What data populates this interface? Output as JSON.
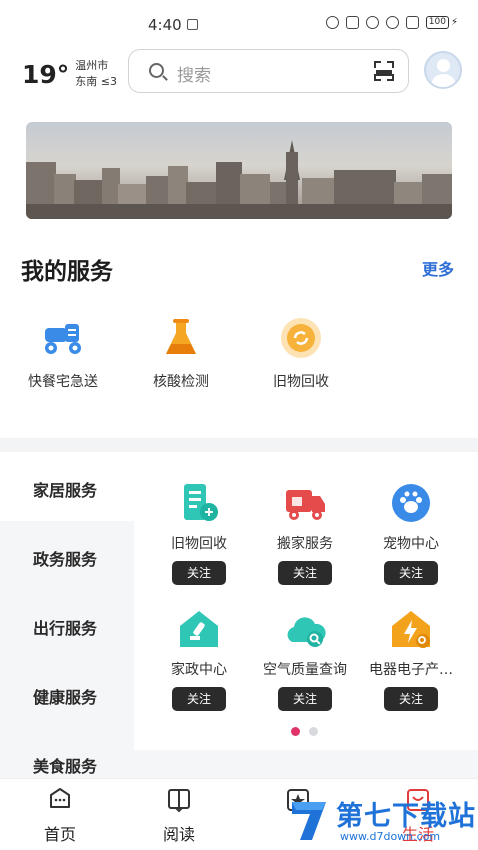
{
  "status_bar": {
    "time": "4:40",
    "battery": "100"
  },
  "header": {
    "temperature": "19°",
    "city": "温州市",
    "weather_sub": "东南 ≤3",
    "search_placeholder": "搜索"
  },
  "my_services": {
    "title": "我的服务",
    "more": "更多",
    "items": [
      {
        "label": "快餐宅急送",
        "icon": "delivery-scooter-icon"
      },
      {
        "label": "核酸检测",
        "icon": "test-tube-icon"
      },
      {
        "label": "旧物回收",
        "icon": "recycle-icon"
      }
    ]
  },
  "categories": [
    {
      "label": "家居服务",
      "active": true
    },
    {
      "label": "政务服务",
      "active": false
    },
    {
      "label": "出行服务",
      "active": false
    },
    {
      "label": "健康服务",
      "active": false
    },
    {
      "label": "美食服务",
      "active": false
    }
  ],
  "category_items": [
    {
      "label": "旧物回收",
      "button": "关注",
      "icon": "document-recycle-icon"
    },
    {
      "label": "搬家服务",
      "button": "关注",
      "icon": "moving-truck-icon"
    },
    {
      "label": "宠物中心",
      "button": "关注",
      "icon": "paw-icon"
    },
    {
      "label": "家政中心",
      "button": "关注",
      "icon": "house-cleaning-icon"
    },
    {
      "label": "空气质量查询",
      "button": "关注",
      "icon": "cloud-air-icon"
    },
    {
      "label": "电器电子产…",
      "button": "关注",
      "icon": "house-lightning-icon"
    }
  ],
  "pager": {
    "pages": 2,
    "current": 1
  },
  "tabbar": [
    {
      "label": "首页",
      "icon": "home-chat-icon"
    },
    {
      "label": "阅读",
      "icon": "book-icon"
    },
    {
      "label": "",
      "icon": "star-card-icon"
    },
    {
      "label": "生活",
      "icon": "life-bag-icon"
    }
  ],
  "watermark": {
    "title": "第七下载站",
    "url": "www.d7down.com"
  },
  "colors": {
    "accent_blue": "#2f6fd6",
    "teal": "#2fc6b6",
    "red": "#e54b4b",
    "orange": "#f3a21b",
    "pink_dot": "#e0336a"
  }
}
